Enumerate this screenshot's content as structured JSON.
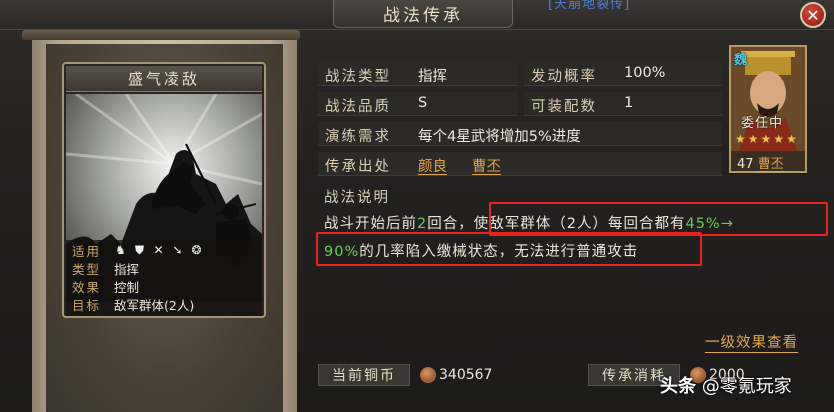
{
  "header": {
    "title": "战法传承",
    "top_link": "[天崩地裂传]",
    "close_icon": "close-icon"
  },
  "card": {
    "name": "盛气凌敌",
    "info": [
      {
        "key": "适用",
        "value": ""
      },
      {
        "key": "类型",
        "value": "指挥"
      },
      {
        "key": "效果",
        "value": "控制"
      },
      {
        "key": "目标",
        "value": "敌军群体(2人)"
      }
    ],
    "applicable_icons": [
      "cavalry-icon",
      "shield-icon",
      "bow-icon",
      "spear-icon",
      "wheel-icon"
    ]
  },
  "details": {
    "type_label": "战法类型",
    "type_value": "指挥",
    "rate_label": "发动概率",
    "rate_value": "100%",
    "quality_label": "战法品质",
    "quality_value": "S",
    "slots_label": "可装配数",
    "slots_value": "1",
    "train_label": "演练需求",
    "train_value": "每个4星武将增加5%进度",
    "origin_label": "传承出处",
    "origin_a": "颜良",
    "origin_b": "曹丕"
  },
  "description": {
    "title": "战法说明",
    "line1_pre": "战斗开始后前",
    "line1_num": "2",
    "line1_mid": "回合，使敌军群体（2人）每回合都有",
    "line1_pct": "45%→",
    "line2_pct": "90%",
    "line2_post": "的几率陷入缴械状态，无法进行普通攻击"
  },
  "effect_link": "一级效果查看",
  "bottom": {
    "copper_label": "当前铜币",
    "copper_value": "340567",
    "cost_label": "传承消耗",
    "cost_value": "2000"
  },
  "hero": {
    "kingdom": "魏",
    "name": "委任中",
    "stars": [
      "★",
      "★",
      "★",
      "★",
      "★"
    ],
    "level": "47",
    "hero_name": "曹丕"
  },
  "watermark": {
    "prefix": "头条",
    "handle": "@零氪玩家"
  },
  "colors": {
    "accent_orange": "#e0a64c",
    "highlight_green": "#6ccb55",
    "annotation_red": "#e8231c",
    "link_blue": "#4a7fd4"
  }
}
